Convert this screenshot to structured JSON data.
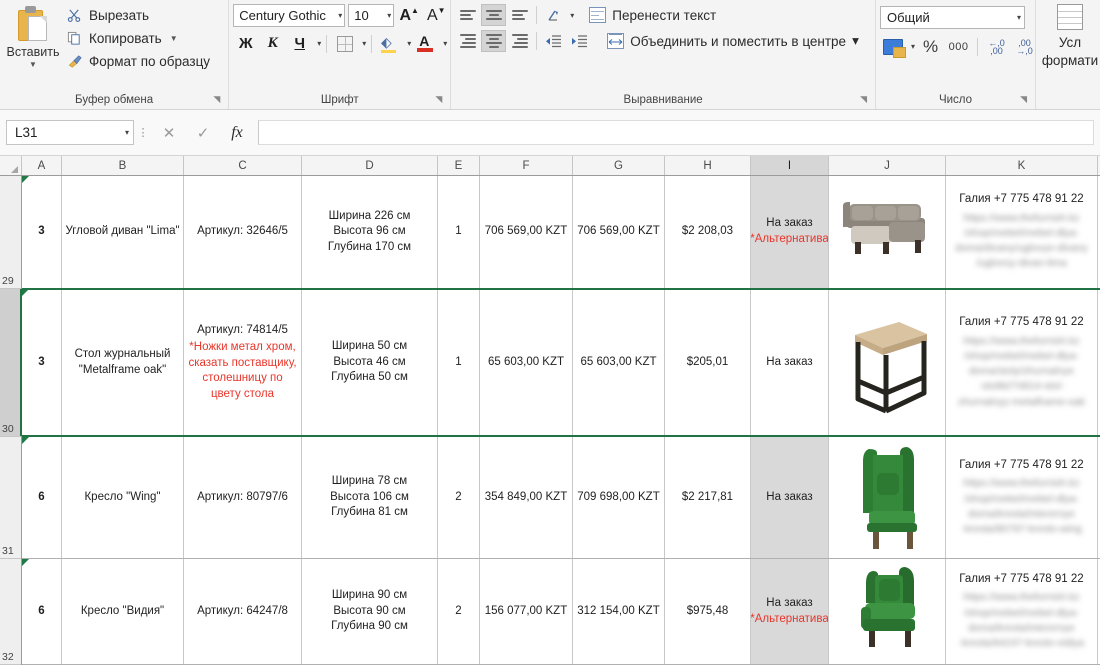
{
  "ribbon": {
    "clipboard": {
      "paste_label": "Вставить",
      "cut_label": "Вырезать",
      "copy_label": "Копировать",
      "format_painter_label": "Формат по образцу",
      "group_label": "Буфер обмена"
    },
    "font": {
      "font_name": "Century Gothic",
      "font_size": "10",
      "bold_label": "Ж",
      "italic_label": "К",
      "underline_label": "Ч",
      "group_label": "Шрифт"
    },
    "alignment": {
      "wrap_text_label": "Перенести текст",
      "merge_center_label": "Объединить и поместить в центре",
      "group_label": "Выравнивание"
    },
    "number": {
      "format_value": "Общий",
      "percent_label": "%",
      "thousands_label": "000",
      "group_label": "Число"
    },
    "styles": {
      "conditional_line1": "Усл",
      "conditional_line2": "формати"
    }
  },
  "formula_bar": {
    "name_box": "L31",
    "cancel_icon": "✕",
    "accept_icon": "✓",
    "function_icon": "fx",
    "formula_value": ""
  },
  "grid": {
    "columns": [
      "A",
      "B",
      "C",
      "D",
      "E",
      "F",
      "G",
      "H",
      "I",
      "J",
      "K"
    ],
    "selected_column": "I",
    "row_numbers": [
      "29",
      "30",
      "31",
      "32"
    ],
    "selected_row": "30",
    "rows": [
      {
        "row_number": "29",
        "qty_group": "3",
        "name": "Угловой диван \"Lima\"",
        "article": "Артикул: 32646/5",
        "article_note": "",
        "dimensions": "Ширина 226 см\nВысота 96 см\nГлубина 170 см",
        "count": "1",
        "price_unit": "706 569,00 KZT",
        "price_total": "706 569,00 KZT",
        "price_usd": "$2 208,03",
        "status": "На заказ",
        "status_note": "*Альтернатива",
        "status_shaded": true,
        "image": "corner-sofa-beige",
        "contact_phone": "Галия +7 775 478 91 22",
        "contact_blurred": "https://www.thefurnish.kz\n/shop/mebel/mebel-dlya-doma/divany/uglovye-divany\n/uglovoy-divan-lima"
      },
      {
        "row_number": "30",
        "qty_group": "3",
        "name": "Стол журнальный \"Metalframe oak\"",
        "article": "Артикул: 74814/5",
        "article_note": "*Ножки метал хром, сказать поставщику, столешницу по цвету стола",
        "dimensions": "Ширина 50 см\nВысота 46 см\nГлубина 50 см",
        "count": "1",
        "price_unit": "65 603,00 KZT",
        "price_total": "65 603,00 KZT",
        "price_usd": "$205,01",
        "status": "На заказ",
        "status_note": "",
        "status_shaded": false,
        "image": "coffee-table-oak",
        "contact_phone": "Галия +7 775 478 91 22",
        "contact_blurred": "https://www.thefurnish.kz\n/shop/mebel/mebel-dlya-doma/stoly/zhurnalnye\n-stoliki/74814-stol-zhurnalnyy-metalframe-oak"
      },
      {
        "row_number": "31",
        "qty_group": "6",
        "name": "Кресло \"Wing\"",
        "article": "Артикул: 80797/6",
        "article_note": "",
        "dimensions": "Ширина 78 см\nВысота 106 см\nГлубина 81 см",
        "count": "2",
        "price_unit": "354 849,00 KZT",
        "price_total": "709 698,00 KZT",
        "price_usd": "$2 217,81",
        "status": "На заказ",
        "status_note": "",
        "status_shaded": true,
        "image": "green-wing-chair",
        "contact_phone": "Галия +7 775 478 91 22",
        "contact_blurred": "https://www.thefurnish.kz\n/shop/mebel/mebel-dlya-doma/kresla/interernye\n-kresla/80797-kreslo-wing"
      },
      {
        "row_number": "32",
        "qty_group": "6",
        "name": "Кресло \"Видия\"",
        "article": "Артикул: 64247/8",
        "article_note": "",
        "dimensions": "Ширина 90 см\nВысота 90 см\nГлубина 90 см",
        "count": "2",
        "price_unit": "156 077,00 KZT",
        "price_total": "312 154,00 KZT",
        "price_usd": "$975,48",
        "status": "На заказ",
        "status_note": "*Альтернатива",
        "status_shaded": true,
        "image": "green-armchair",
        "contact_phone": "Галия +7 775 478 91 22",
        "contact_blurred": "https://www.thefurnish.kz\n/shop/mebel/mebel-dlya-doma/kresla/interernye\n-kresla/64247-kreslo-vidiya"
      }
    ]
  },
  "colors": {
    "accent_green": "#217346",
    "note_red": "#e8352a",
    "shaded_cell": "#d9d9d9"
  }
}
